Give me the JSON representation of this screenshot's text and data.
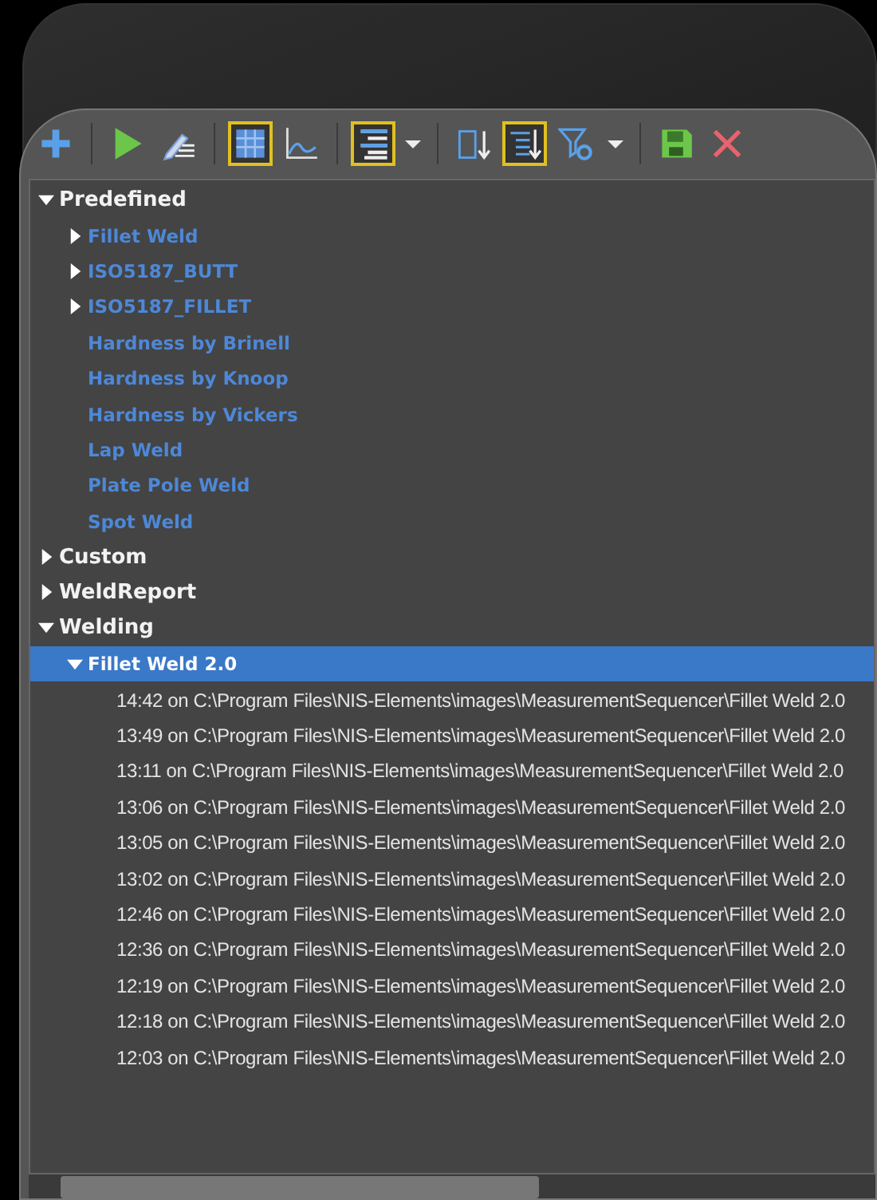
{
  "toolbar": [
    {
      "kind": "add"
    },
    {
      "kind": "separator"
    },
    {
      "kind": "run"
    },
    {
      "kind": "edit"
    },
    {
      "kind": "separator"
    },
    {
      "kind": "table",
      "selected": true
    },
    {
      "kind": "graph",
      "selected": false
    },
    {
      "kind": "separator"
    },
    {
      "kind": "align",
      "selected": true
    },
    {
      "kind": "dropdown"
    },
    {
      "kind": "separator"
    },
    {
      "kind": "sort-number",
      "selected": false
    },
    {
      "kind": "sort-list",
      "selected": true
    },
    {
      "kind": "filter",
      "selected": false
    },
    {
      "kind": "dropdown"
    },
    {
      "kind": "separator"
    },
    {
      "kind": "save"
    },
    {
      "kind": "delete"
    }
  ],
  "tree": [
    {
      "label": "Predefined",
      "kind": "folder",
      "expanded": true,
      "selected": false,
      "children": [
        {
          "label": "Fillet Weld",
          "kind": "folder",
          "expanded": false,
          "selected": false
        },
        {
          "label": "ISO5187_BUTT",
          "kind": "folder",
          "expanded": false,
          "selected": false
        },
        {
          "label": "ISO5187_FILLET",
          "kind": "folder",
          "expanded": false,
          "selected": false
        },
        {
          "label": "Hardness by Brinell",
          "kind": "leaf",
          "selected": false
        },
        {
          "label": "Hardness by Knoop",
          "kind": "leaf",
          "selected": false
        },
        {
          "label": "Hardness by Vickers",
          "kind": "leaf",
          "selected": false
        },
        {
          "label": "Lap Weld",
          "kind": "leaf",
          "selected": false
        },
        {
          "label": "Plate Pole Weld",
          "kind": "leaf",
          "selected": false
        },
        {
          "label": "Spot Weld",
          "kind": "leaf",
          "selected": false
        }
      ]
    },
    {
      "label": "Custom",
      "kind": "folder",
      "expanded": false,
      "selected": false
    },
    {
      "label": "WeldReport",
      "kind": "folder",
      "expanded": false,
      "selected": false
    },
    {
      "label": "Welding",
      "kind": "folder",
      "expanded": true,
      "selected": false,
      "children": [
        {
          "label": "Fillet Weld 2.0",
          "kind": "folder",
          "expanded": true,
          "selected": true,
          "children": [
            {
              "label": "14:42 on C:\\Program Files\\NIS-Elements\\images\\MeasurementSequencer\\Fillet Weld 2.0",
              "kind": "leaf",
              "selected": false
            },
            {
              "label": "13:49 on C:\\Program Files\\NIS-Elements\\images\\MeasurementSequencer\\Fillet Weld 2.0",
              "kind": "leaf",
              "selected": false
            },
            {
              "label": "13:11 on C:\\Program Files\\NIS-Elements\\images\\MeasurementSequencer\\Fillet Weld 2.0",
              "kind": "leaf",
              "selected": false
            },
            {
              "label": "13:06 on C:\\Program Files\\NIS-Elements\\images\\MeasurementSequencer\\Fillet Weld 2.0",
              "kind": "leaf",
              "selected": false
            },
            {
              "label": "13:05 on C:\\Program Files\\NIS-Elements\\images\\MeasurementSequencer\\Fillet Weld 2.0",
              "kind": "leaf",
              "selected": false
            },
            {
              "label": "13:02 on C:\\Program Files\\NIS-Elements\\images\\MeasurementSequencer\\Fillet Weld 2.0",
              "kind": "leaf",
              "selected": false
            },
            {
              "label": "12:46 on C:\\Program Files\\NIS-Elements\\images\\MeasurementSequencer\\Fillet Weld 2.0",
              "kind": "leaf",
              "selected": false
            },
            {
              "label": "12:36 on C:\\Program Files\\NIS-Elements\\images\\MeasurementSequencer\\Fillet Weld 2.0",
              "kind": "leaf",
              "selected": false
            },
            {
              "label": "12:19 on C:\\Program Files\\NIS-Elements\\images\\MeasurementSequencer\\Fillet Weld 2.0",
              "kind": "leaf",
              "selected": false
            },
            {
              "label": "12:18 on C:\\Program Files\\NIS-Elements\\images\\MeasurementSequencer\\Fillet Weld 2.0",
              "kind": "leaf",
              "selected": false
            },
            {
              "label": "12:03 on C:\\Program Files\\NIS-Elements\\images\\MeasurementSequencer\\Fillet Weld 2.0",
              "kind": "leaf",
              "selected": false
            }
          ]
        }
      ]
    }
  ]
}
